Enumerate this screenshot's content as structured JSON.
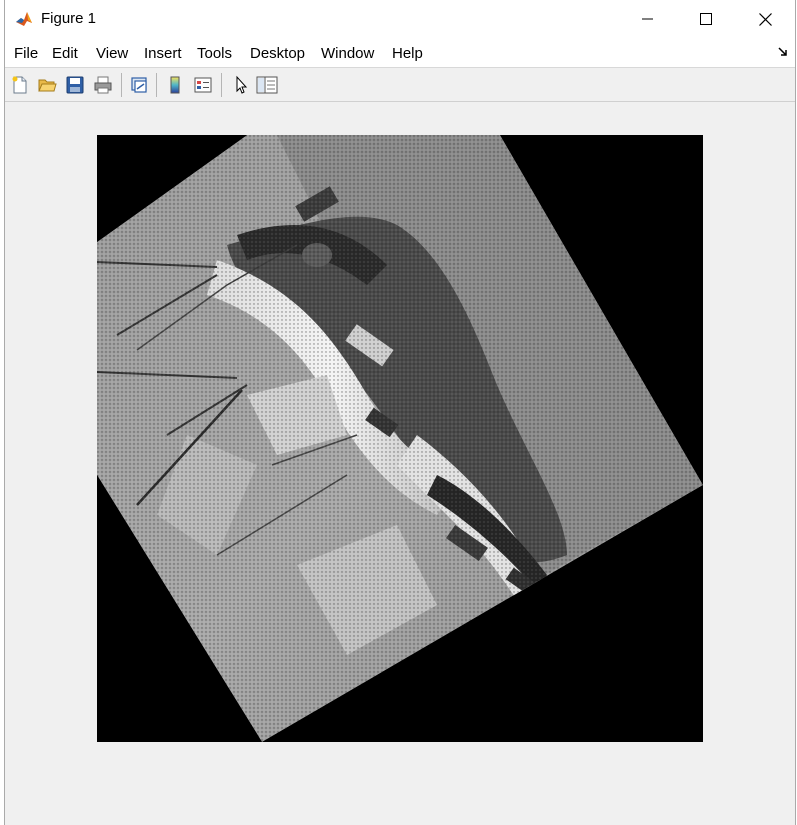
{
  "window": {
    "title": "Figure 1",
    "controls": {
      "minimize": "minimize-icon",
      "maximize": "maximize-icon",
      "close": "close-icon"
    }
  },
  "menubar": {
    "items": [
      {
        "label": "File"
      },
      {
        "label": "Edit"
      },
      {
        "label": "View"
      },
      {
        "label": "Insert"
      },
      {
        "label": "Tools"
      },
      {
        "label": "Desktop"
      },
      {
        "label": "Window"
      },
      {
        "label": "Help"
      }
    ]
  },
  "toolbar": {
    "buttons": [
      {
        "icon": "new-figure-icon"
      },
      {
        "icon": "open-file-icon"
      },
      {
        "icon": "save-icon"
      },
      {
        "icon": "print-icon"
      },
      {
        "icon": "link-plot-icon"
      },
      {
        "icon": "insert-colorbar-icon"
      },
      {
        "icon": "insert-legend-icon"
      },
      {
        "icon": "edit-plot-pointer-icon"
      },
      {
        "icon": "property-inspector-icon"
      }
    ]
  },
  "figure": {
    "image": "rotated grayscale aerial image of industrial equipment on black background"
  }
}
